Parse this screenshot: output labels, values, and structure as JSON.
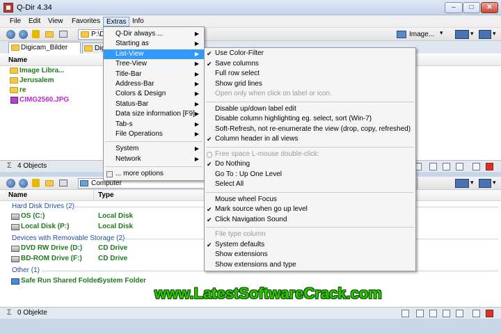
{
  "window": {
    "title": "Q-Dir 4.34",
    "controls": {
      "minimize": "–",
      "maximize": "□",
      "close": "✕"
    }
  },
  "menubar": [
    "File",
    "Edit",
    "View",
    "Favorites",
    "Extras",
    "Info"
  ],
  "toolbar_top": {
    "address_value": "P:\\D",
    "image_button_label": "Image..."
  },
  "top_pane": {
    "tabs": [
      "Digicam_Bilder",
      "Digicam"
    ],
    "column_name": "Name",
    "items": [
      {
        "name": "Image Libra...",
        "kind": "folder"
      },
      {
        "name": "Jerusalem",
        "kind": "folder"
      },
      {
        "name": "re",
        "kind": "folder"
      },
      {
        "name": "CIMG2560.JPG",
        "kind": "image"
      }
    ],
    "status": "4 Objects"
  },
  "bottom_pane": {
    "address_value": "Computer",
    "column_name": "Name",
    "column_type": "Type",
    "groups": [
      {
        "label": "Hard Disk Drives (2)",
        "rows": [
          {
            "name": "OS (C:)",
            "type": "Local Disk"
          },
          {
            "name": "Local Disk (P:)",
            "type": "Local Disk"
          }
        ]
      },
      {
        "label": "Devices with Removable Storage (2)",
        "rows": [
          {
            "name": "DVD RW Drive (D:)",
            "type": "CD Drive"
          },
          {
            "name": "BD-ROM Drive (F:)",
            "type": "CD Drive"
          }
        ]
      },
      {
        "label": "Other (1)",
        "rows": [
          {
            "name": "Safe Run Shared Folder",
            "type": "System Folder"
          }
        ]
      }
    ],
    "status": "0 Objekte"
  },
  "extras_menu": {
    "items": [
      {
        "label": "Q-Dir always ...",
        "submenu": true
      },
      {
        "label": "Starting as",
        "submenu": true
      },
      {
        "label": "List-View",
        "submenu": true,
        "highlight": true
      },
      {
        "label": "Tree-View",
        "submenu": true
      },
      {
        "label": "Title-Bar",
        "submenu": true
      },
      {
        "label": "Address-Bar",
        "submenu": true
      },
      {
        "label": "Colors & Design",
        "submenu": true
      },
      {
        "label": "Status-Bar",
        "submenu": true
      },
      {
        "label": "Data size information  [F9]",
        "submenu": true
      },
      {
        "label": "Tab-s",
        "submenu": true
      },
      {
        "label": "File Operations",
        "submenu": true
      }
    ],
    "items2": [
      {
        "label": "System",
        "submenu": true
      },
      {
        "label": "Network",
        "submenu": true
      }
    ],
    "more": "... more options"
  },
  "listview_submenu": {
    "groups": [
      [
        {
          "label": "Use Color-Filter",
          "checked": true
        },
        {
          "label": "Save columns",
          "checked": true
        },
        {
          "label": "Full row select",
          "checked": false
        },
        {
          "label": "Show grid lines",
          "checked": false
        },
        {
          "label": "Open only when click on label or icon.",
          "checked": false,
          "disabled": true
        }
      ],
      [
        {
          "label": "Disable up/down label edit",
          "checked": false
        },
        {
          "label": "Disable column highlighting eg. select, sort (Win-7)",
          "checked": false
        },
        {
          "label": "Soft-Refresh, not re-enumerate the view (drop, copy, refreshed)",
          "checked": false
        },
        {
          "label": "Column header in all views",
          "checked": true
        }
      ],
      [
        {
          "label": "Free space L-mouse double-click:",
          "checked": false,
          "disabled": true
        },
        {
          "label": "Do Nothing",
          "checked": true
        },
        {
          "label": "Go To : Up One Level",
          "checked": false
        },
        {
          "label": "Select All",
          "checked": false
        }
      ],
      [
        {
          "label": "Mouse wheel Focus",
          "checked": false
        },
        {
          "label": "Mark source when go up level",
          "checked": true
        },
        {
          "label": "Click Navigation Sound",
          "checked": true
        }
      ],
      [
        {
          "label": "File type column",
          "checked": false,
          "disabled": true
        },
        {
          "label": "System defaults",
          "checked": true
        },
        {
          "label": "Show extensions",
          "checked": false
        },
        {
          "label": "Show extensions and type",
          "checked": false
        }
      ]
    ],
    "check_glyph": "✔"
  },
  "watermark": "www.LatestSoftwareCrack.com",
  "sum_glyph": "Σ"
}
